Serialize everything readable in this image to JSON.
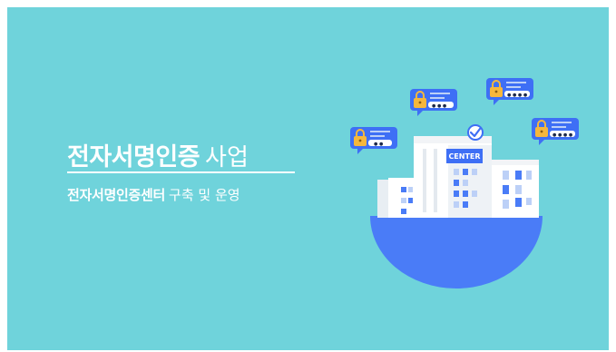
{
  "slide": {
    "title_bold": "전자서명인증",
    "title_light": "사업",
    "subtitle_bold": "전자서명인증센터",
    "subtitle_light": "구축 및 운영",
    "background_color": "#6fd3db"
  },
  "illustration": {
    "building_sign": "CENTER",
    "globe_color": "#4a7cf7",
    "badge_color": "#3e6ff5",
    "lock_color": "#f6b73c",
    "password_fields": [
      {
        "icon": "lock-icon",
        "masked": "● ●"
      },
      {
        "icon": "lock-icon",
        "masked": "● ● ●"
      },
      {
        "icon": "lock-icon",
        "masked": "● ● ● ●"
      },
      {
        "icon": "lock-icon",
        "masked": "● ● ● ●"
      }
    ],
    "check_icon": "checkmark-icon"
  }
}
